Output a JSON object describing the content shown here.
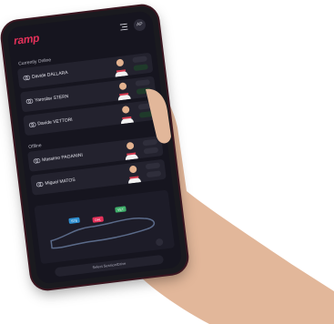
{
  "app": {
    "logo": "ramp",
    "avatar_initials": "AP"
  },
  "sections": [
    {
      "title": "Currently Online",
      "drivers": [
        {
          "name": "Davide DALLARA"
        },
        {
          "name": "Yaroslav STERN"
        },
        {
          "name": "Davide VETTORI"
        }
      ]
    },
    {
      "title": "Offline",
      "drivers": [
        {
          "name": "Massimo PAGANINI"
        },
        {
          "name": "Miguel MATOS"
        }
      ]
    }
  ],
  "map": {
    "markers": [
      "STE",
      "DAL",
      "VET"
    ]
  },
  "bottom_button": "Select Session/Drive",
  "colors": {
    "accent": "#e4315a",
    "background": "#16151f",
    "card": "#23222e",
    "status_green": "#3fc77a"
  }
}
